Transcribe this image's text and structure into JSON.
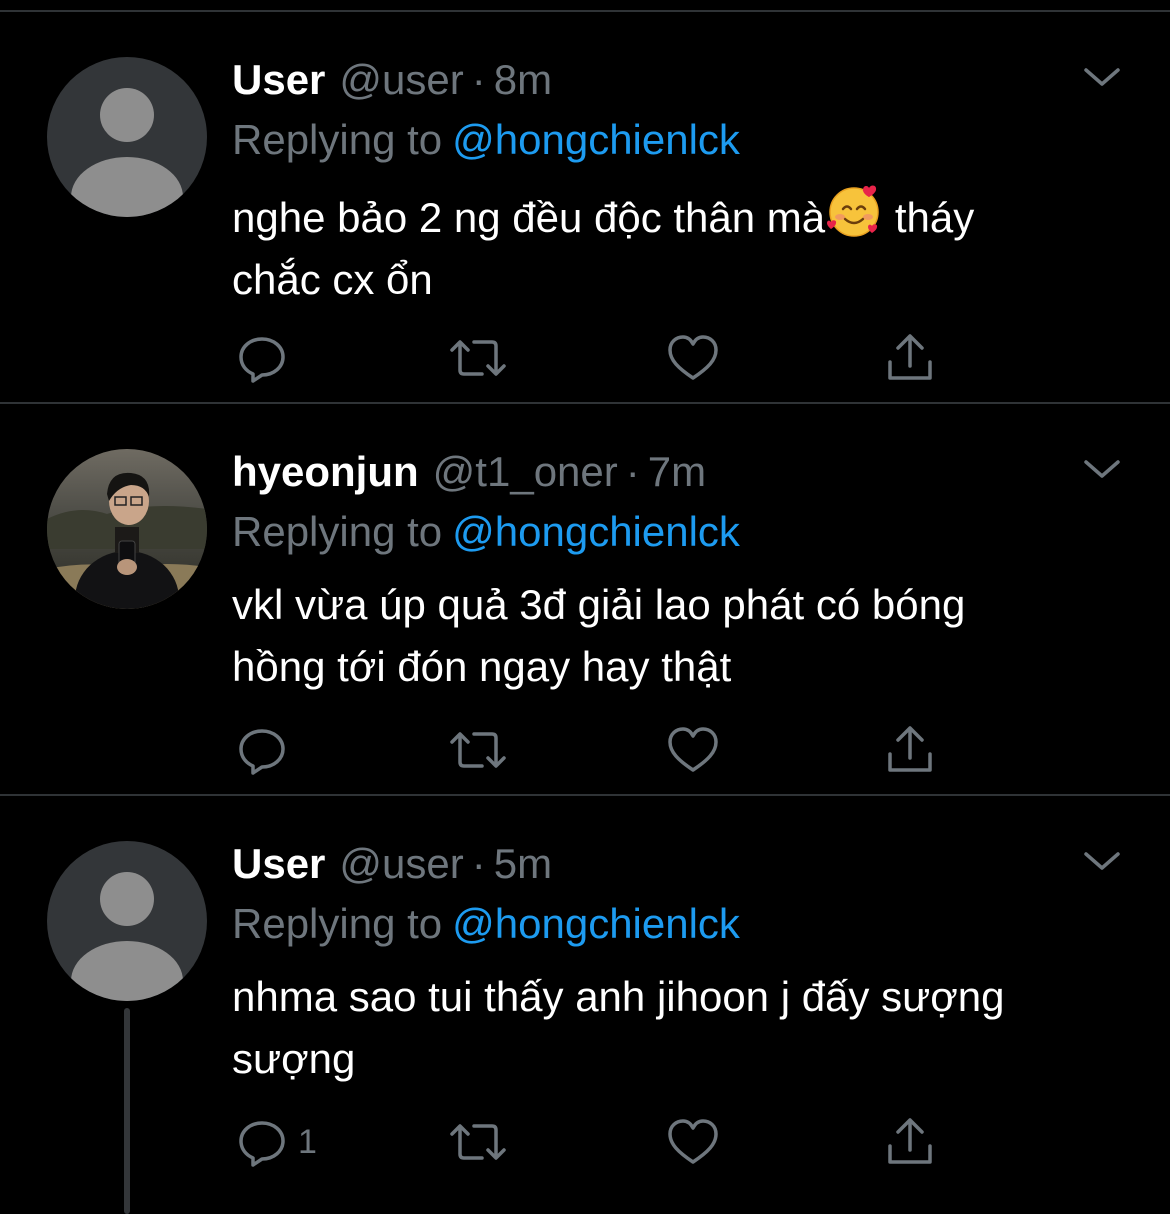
{
  "tweets": [
    {
      "display_name": "User",
      "handle": "@user",
      "separator": "·",
      "time": "8m",
      "replying_prefix": "Replying to",
      "replying_to": "@hongchienlck",
      "text_line1_a": "nghe bảo 2 ng đều độc thân mà",
      "text_line1_b": " tháy",
      "text_line2": "chắc cx ổn",
      "emoji": "smiling-face-with-hearts",
      "reply_count": "",
      "avatar": "default-avatar"
    },
    {
      "display_name": "hyeonjun",
      "handle": "@t1_oner",
      "separator": "·",
      "time": "7m",
      "replying_prefix": "Replying to",
      "replying_to": "@hongchienlck",
      "text_line1": "vkl vừa úp quả 3đ giải lao phát có bóng",
      "text_line2": "hồng tới đón ngay hay thật",
      "reply_count": "",
      "avatar": "photo-avatar"
    },
    {
      "display_name": "User",
      "handle": "@user",
      "separator": "·",
      "time": "5m",
      "replying_prefix": "Replying to",
      "replying_to": "@hongchienlck",
      "text_line1": "nhma sao tui thấy anh jihoon j đấy sượng",
      "text_line2": "sượng",
      "reply_count": "1",
      "avatar": "default-avatar"
    }
  ],
  "colors": {
    "background": "#000000",
    "text": "#ffffff",
    "muted": "#6e767d",
    "link": "#1d9bf0",
    "divider": "#2f3336"
  }
}
